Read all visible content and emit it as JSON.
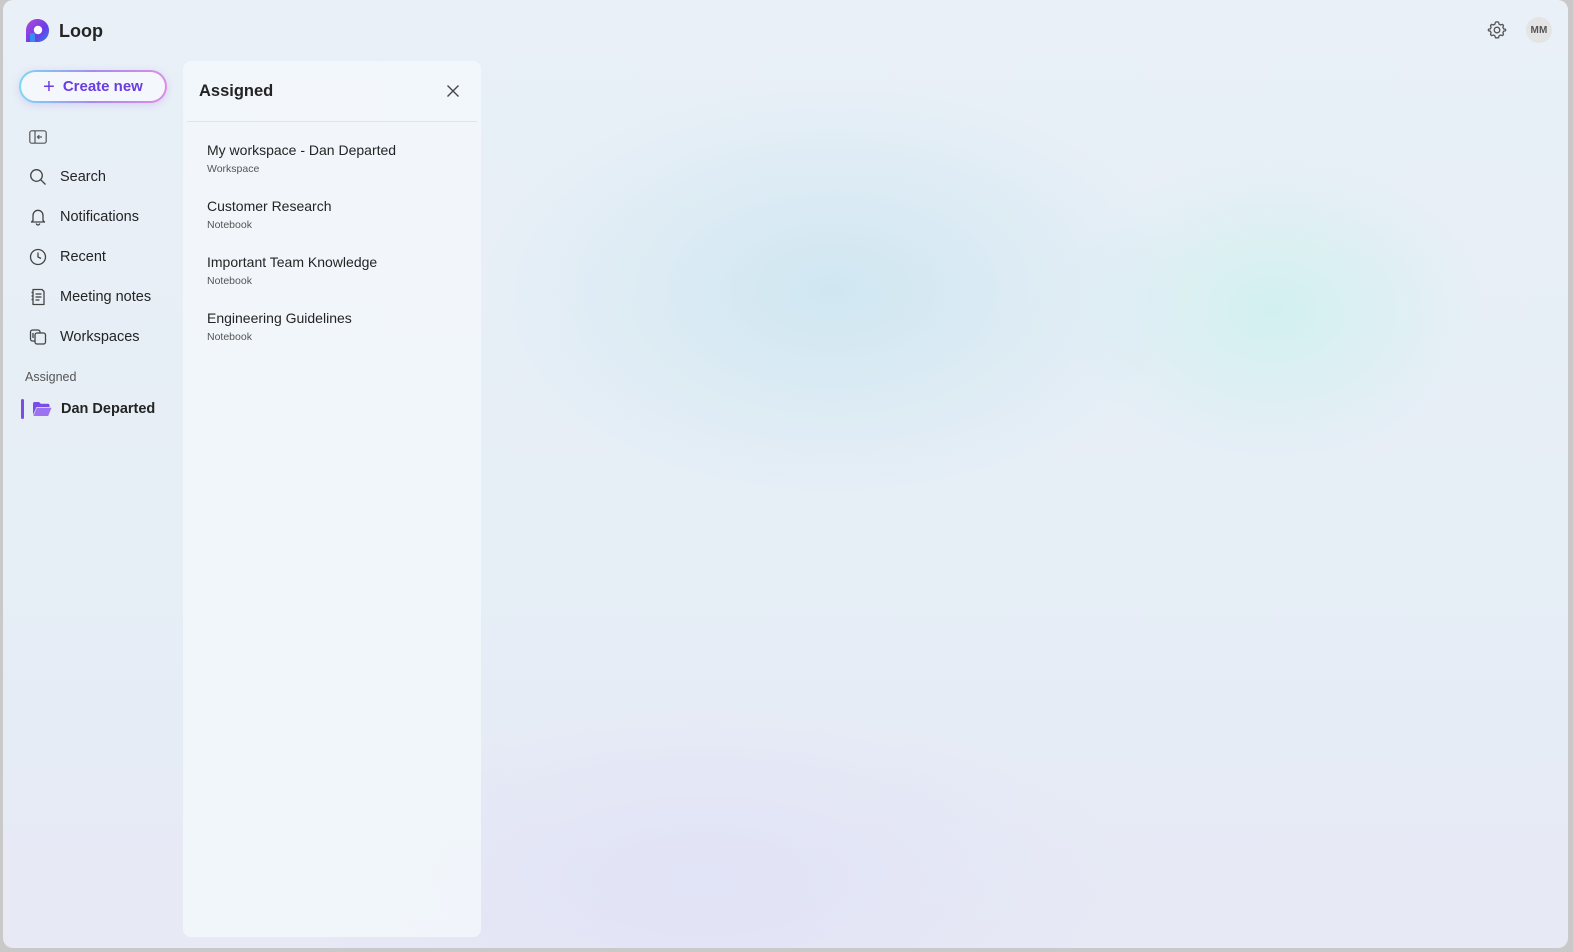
{
  "app": {
    "title": "Loop"
  },
  "header": {
    "avatar_initials": "MM",
    "settings_icon": "gear-icon"
  },
  "sidebar": {
    "create_label": "Create new",
    "items": [
      {
        "label": "Search",
        "icon": "search-icon"
      },
      {
        "label": "Notifications",
        "icon": "bell-icon"
      },
      {
        "label": "Recent",
        "icon": "clock-icon"
      },
      {
        "label": "Meeting notes",
        "icon": "notes-icon"
      },
      {
        "label": "Workspaces",
        "icon": "workspaces-icon"
      }
    ],
    "section_label": "Assigned",
    "assigned_items": [
      {
        "label": "Dan Departed",
        "icon": "folder-open-icon"
      }
    ]
  },
  "panel": {
    "title": "Assigned",
    "items": [
      {
        "title": "My workspace - Dan Departed",
        "type": "Workspace"
      },
      {
        "title": "Customer Research",
        "type": "Notebook"
      },
      {
        "title": "Important Team Knowledge",
        "type": "Notebook"
      },
      {
        "title": "Engineering Guidelines",
        "type": "Notebook"
      }
    ]
  },
  "colors": {
    "accent": "#7a4ee6",
    "create_text": "#6a3de0"
  }
}
